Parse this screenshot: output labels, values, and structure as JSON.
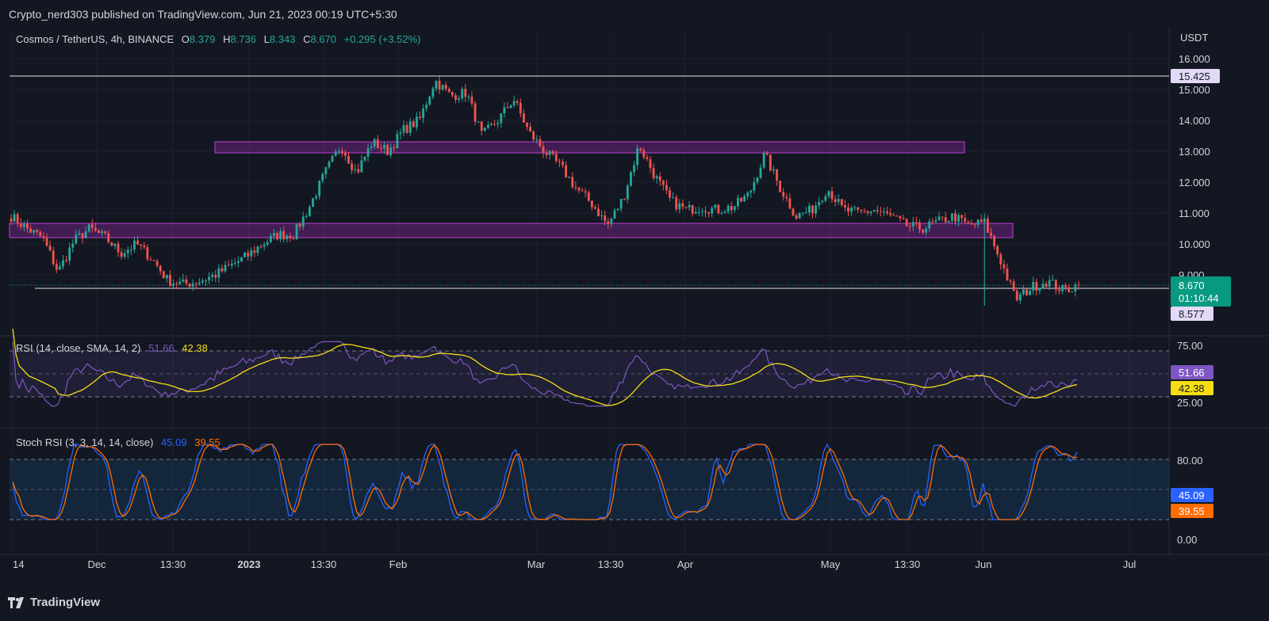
{
  "header": {
    "published": "Crypto_nerd303 published on TradingView.com, Jun 21, 2023 00:19 UTC+5:30"
  },
  "legend": {
    "symbol": "Cosmos / TetherUS, 4h, BINANCE",
    "o_label": "O",
    "o_value": "8.379",
    "h_label": "H",
    "h_value": "8.736",
    "l_label": "L",
    "l_value": "8.343",
    "c_label": "C",
    "c_value": "8.670",
    "change": "+0.295 (+3.52%)"
  },
  "price_axis": {
    "currency": "USDT",
    "ticks": [
      "16.000",
      "15.000",
      "14.000",
      "13.000",
      "12.000",
      "11.000",
      "10.000",
      "9.000"
    ],
    "tick_values": [
      16,
      15,
      14,
      13,
      12,
      11,
      10,
      9
    ],
    "hline_label": "15.425",
    "last_price": "8.670",
    "countdown": "01:10:44",
    "support_label": "8.577"
  },
  "rsi": {
    "title": "RSI (14, close, SMA, 14, 2)",
    "rsi_value": "51.66",
    "ma_value": "42.38",
    "ticks": [
      "75.00",
      "25.00"
    ],
    "badge_rsi": "51.66",
    "badge_ma": "42.38"
  },
  "stoch": {
    "title": "Stoch RSI (3, 3, 14, 14, close)",
    "k_value": "45.09",
    "d_value": "39.55",
    "ticks": [
      "80.00",
      "0.00"
    ],
    "badge_k": "45.09",
    "badge_d": "39.55"
  },
  "time_axis": [
    "14",
    "Dec",
    "13:30",
    "2023",
    "13:30",
    "Feb",
    "Mar",
    "13:30",
    "Apr",
    "May",
    "13:30",
    "Jun",
    "Jul"
  ],
  "footer": {
    "brand": "TradingView"
  },
  "colors": {
    "background": "#131722",
    "up": "#26a69a",
    "down": "#ef5350",
    "zone": "#9c27b0",
    "rsi": "#7e57c2",
    "rsi_ma": "#f5de15",
    "stoch_k": "#2962ff",
    "stoch_d": "#ff6d00",
    "last_price_badge": "#089981",
    "label_bg": "#e1d9f5"
  },
  "chart_data": {
    "type": "line",
    "title": "Cosmos / TetherUS, 4h, BINANCE",
    "series": [
      {
        "name": "Cosmos / TetherUS",
        "values": [
          10.9,
          10.5,
          10.2,
          9.1,
          10.1,
          10.5,
          10.2,
          9.7,
          10.0,
          9.5,
          8.8,
          8.7,
          8.8,
          9.0,
          9.3,
          9.6,
          10.0,
          10.3,
          10.3,
          11.2,
          12.3,
          13.2,
          12.3,
          13.3,
          13.0,
          13.7,
          14.0,
          15.3,
          14.8,
          14.9,
          13.5,
          14.0,
          14.7,
          13.6,
          13.0,
          12.5,
          11.8,
          11.3,
          10.6,
          11.5,
          13.2,
          12.2,
          11.4,
          11.1,
          11.2,
          11.1,
          11.2,
          11.6,
          12.9,
          11.8,
          10.9,
          11.1,
          11.8,
          11.1,
          11.0,
          11.1,
          10.9,
          10.6,
          10.5,
          10.7,
          10.9,
          10.6,
          10.7,
          9.5,
          8.2,
          8.6,
          8.8,
          8.5,
          8.67
        ]
      }
    ],
    "zones": [
      {
        "name": "resistance zone",
        "y_from": 12.95,
        "y_to": 13.3
      },
      {
        "name": "support zone",
        "y_from": 10.15,
        "y_to": 10.62
      }
    ],
    "hlines": [
      15.425,
      8.577
    ],
    "ylim": [
      8.0,
      16.3
    ]
  }
}
